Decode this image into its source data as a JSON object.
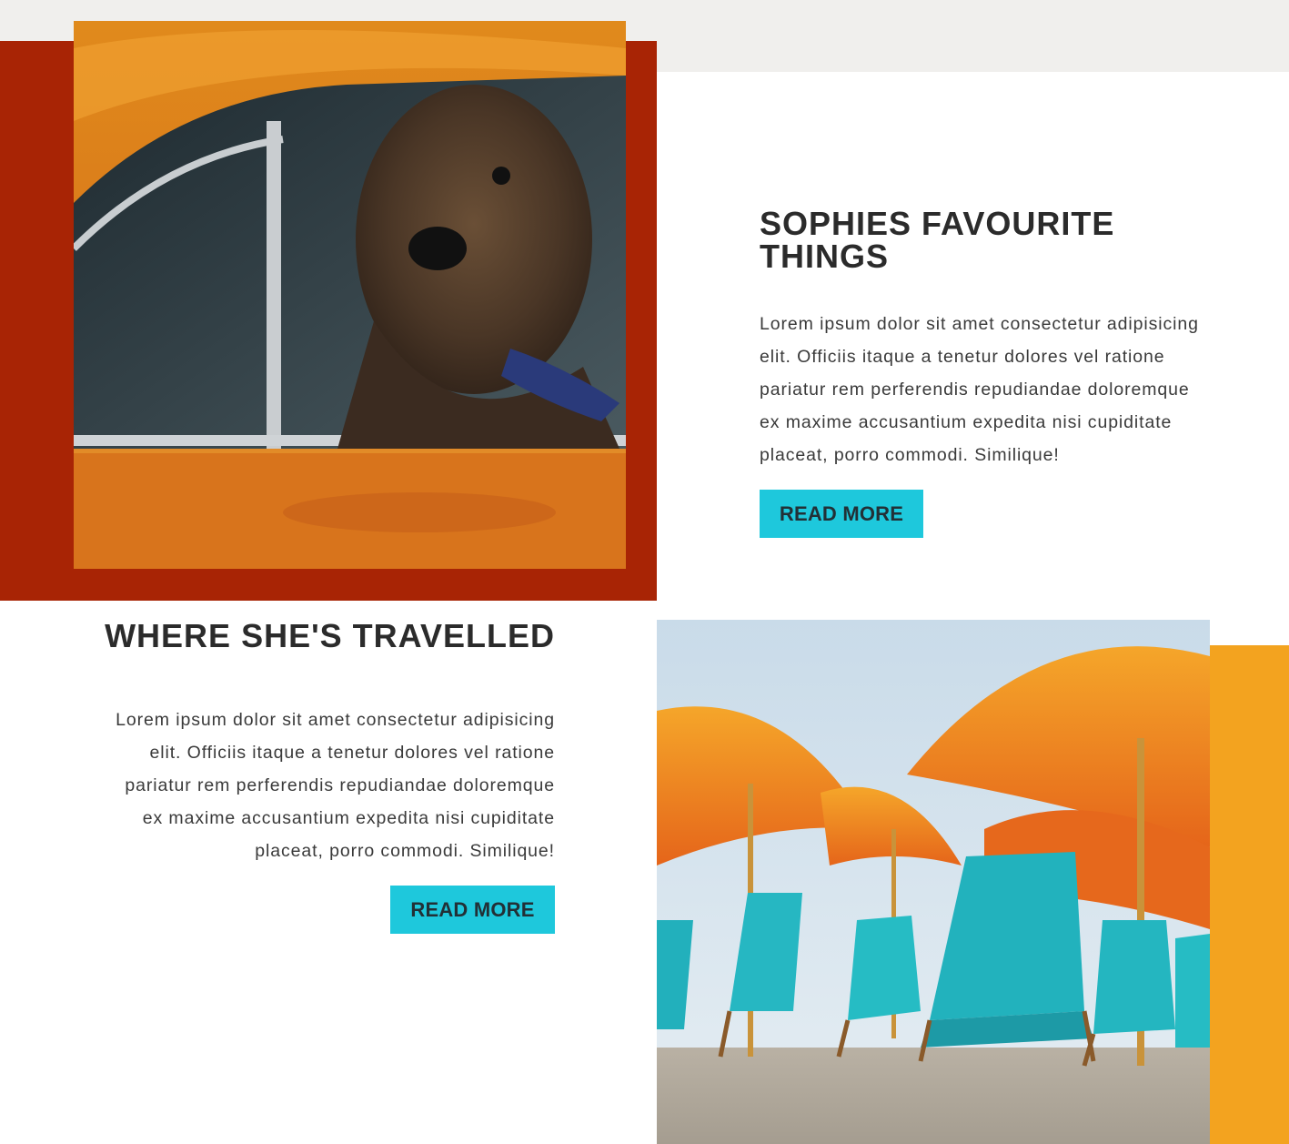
{
  "colors": {
    "top_band": "#f0efed",
    "red_block": "#a82405",
    "orange_block": "#f3a31f",
    "button": "#1ec8dc",
    "text": "#2b2b2b"
  },
  "section_1": {
    "image_alt": "dog in an orange car window",
    "heading": "SOPHIES FAVOURITE THINGS",
    "body": "Lorem ipsum dolor sit amet consectetur adipisicing elit. Officiis itaque a tenetur dolores vel ratione pariatur rem perferendis repudiandae doloremque ex maxime accusantium expedita nisi cupiditate placeat, porro commodi. Similique!",
    "button_label": "READ MORE"
  },
  "section_2": {
    "image_alt": "orange beach umbrellas and teal beach chairs",
    "heading": "WHERE SHE'S TRAVELLED",
    "body": "Lorem ipsum dolor sit amet consectetur adipisicing elit. Officiis itaque a tenetur dolores vel ratione pariatur rem perferendis repudiandae doloremque ex maxime accusantium expedita nisi cupiditate placeat, porro commodi. Similique!",
    "button_label": "READ MORE"
  }
}
